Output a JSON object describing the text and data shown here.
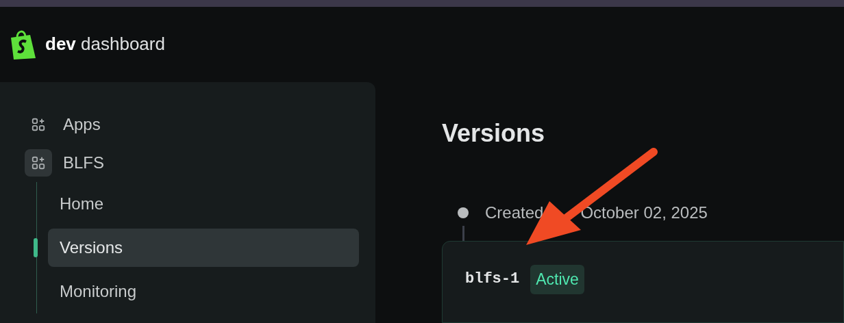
{
  "header": {
    "brand_bold": "dev",
    "brand_rest": "dashboard"
  },
  "sidebar": {
    "items": [
      {
        "label": "Apps",
        "kind": "top",
        "selected": false
      },
      {
        "label": "BLFS",
        "kind": "app",
        "selected": false,
        "children": [
          {
            "label": "Home",
            "selected": false
          },
          {
            "label": "Versions",
            "selected": true
          },
          {
            "label": "Monitoring",
            "selected": false
          }
        ]
      }
    ]
  },
  "main": {
    "title": "Versions",
    "timeline": [
      {
        "text_before": "Created",
        "text_after": "October 02, 2025"
      }
    ],
    "versions": [
      {
        "name": "blfs-1",
        "status": "Active",
        "kind": "active"
      }
    ]
  }
}
